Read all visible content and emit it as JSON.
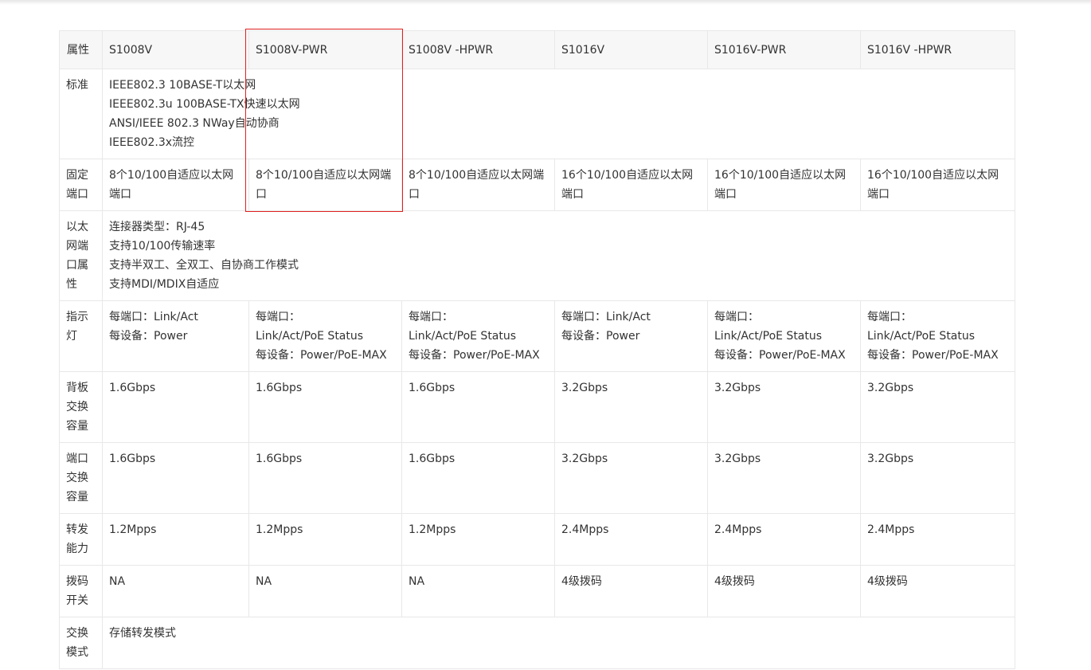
{
  "header": {
    "label": "属性",
    "models": [
      "S1008V",
      "S1008V-PWR",
      "S1008V -HPWR",
      "S1016V",
      "S1016V-PWR",
      "S1016V -HPWR"
    ]
  },
  "rows": {
    "standard": {
      "label": "标准",
      "lines": [
        "IEEE802.3 10BASE-T以太网",
        "IEEE802.3u 100BASE-TX快速以太网",
        "ANSI/IEEE 802.3 NWay自动协商",
        "IEEE802.3x流控"
      ]
    },
    "fixed_ports": {
      "label": "固定端口",
      "values": [
        "8个10/100自适应以太网端口",
        "8个10/100自适应以太网端口",
        "8个10/100自适应以太网端口",
        "16个10/100自适应以太网端口",
        "16个10/100自适应以太网端口",
        "16个10/100自适应以太网端口"
      ]
    },
    "eth_port_props": {
      "label": "以太网端口属性",
      "lines": [
        "连接器类型：RJ-45",
        "支持10/100传输速率",
        "支持半双工、全双工、自协商工作模式",
        "支持MDI/MDIX自适应"
      ]
    },
    "indicators": {
      "label": "指示灯",
      "values": [
        [
          "每端口：Link/Act",
          "每设备：Power"
        ],
        [
          "每端口：",
          "Link/Act/PoE Status",
          "每设备：Power/PoE-MAX"
        ],
        [
          "每端口：",
          "Link/Act/PoE Status",
          "每设备：Power/PoE-MAX"
        ],
        [
          "每端口：Link/Act",
          "每设备：Power"
        ],
        [
          "每端口：",
          "Link/Act/PoE Status",
          "每设备：Power/PoE-MAX"
        ],
        [
          "每端口：",
          "Link/Act/PoE Status",
          "每设备：Power/PoE-MAX"
        ]
      ]
    },
    "backplane_capacity": {
      "label": "背板交换容量",
      "values": [
        "1.6Gbps",
        "1.6Gbps",
        "1.6Gbps",
        "3.2Gbps",
        "3.2Gbps",
        "3.2Gbps"
      ]
    },
    "port_capacity": {
      "label": "端口交换容量",
      "values": [
        "1.6Gbps",
        "1.6Gbps",
        "1.6Gbps",
        "3.2Gbps",
        "3.2Gbps",
        "3.2Gbps"
      ]
    },
    "forwarding": {
      "label": "转发能力",
      "values": [
        "1.2Mpps",
        "1.2Mpps",
        "1.2Mpps",
        "2.4Mpps",
        "2.4Mpps",
        "2.4Mpps"
      ]
    },
    "dip_switch": {
      "label": "拨码开关",
      "values": [
        "NA",
        "NA",
        "NA",
        "4级拨码",
        "4级拨码",
        "4级拨码"
      ]
    },
    "switch_mode": {
      "label": "交换模式",
      "value": "存储转发模式"
    }
  },
  "colors": {
    "highlight_border": "#e02020",
    "header_bg": "#f7f7f7",
    "border": "#e8e8e8"
  }
}
